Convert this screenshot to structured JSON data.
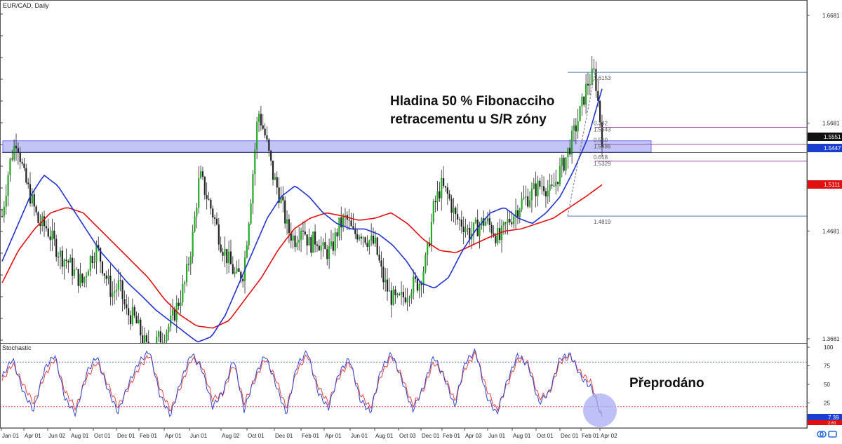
{
  "header": {
    "symbol_label": "EUR/CAD, Daily"
  },
  "colors": {
    "background": "#ffffff",
    "up_candle": "#22aa22",
    "down_candle": "#222222",
    "ma_fast": "#2233cc",
    "ma_slow": "#e01010",
    "sr_zone": "#9a9cf0",
    "fib_lines": "#a050a0",
    "fib_top_bottom": "#4a7fb0",
    "stoch_k": "#3344cc",
    "stoch_d": "#dd4444",
    "stoch_level": "#6677dd",
    "oversold_circle": "#a8acf2",
    "price_badge_current": "#111111",
    "price_badge_zone": "#1a3fd0",
    "price_badge_ma": "#e01010"
  },
  "annotations": {
    "fib_note_line1": "Hladina 50 % Fibonacciho",
    "fib_note_line2": "retracementu u S/R zóny",
    "oversold_note": "Přeprodáno"
  },
  "chart_data": [
    {
      "type": "candlestick",
      "title": "EUR/CAD, Daily",
      "ylim": [
        1.3681,
        1.6681
      ],
      "y_ticks": [
        "1.6681",
        "1.5681",
        "1.4681",
        "1.3681"
      ],
      "x_tick_labels": [
        "Jan 01",
        "Apr 01",
        "Jun 02",
        "Aug 01",
        "Oct 01",
        "Dec 01",
        "Feb 01",
        "Apr 01",
        "Jun 01",
        "Aug 02",
        "Oct 01",
        "Dec 01",
        "Feb 01",
        "Apr 01",
        "Jun 01",
        "Aug 01",
        "Oct 03",
        "Dec 01",
        "Feb 01",
        "Apr 03",
        "Jun 01",
        "Aug 01",
        "Oct 01",
        "Dec 01",
        "Feb 01",
        "Apr 02"
      ],
      "price_badges": [
        {
          "label": "1.5551",
          "role": "current"
        },
        {
          "label": "1.5447",
          "role": "zone"
        },
        {
          "label": "1.5111",
          "role": "ma"
        }
      ],
      "sr_zone": [
        1.5412,
        1.5518
      ],
      "fibonacci": {
        "levels": [
          {
            "ratio": "",
            "price": "1.6153"
          },
          {
            "ratio": "0.382",
            "price": "1.5643"
          },
          {
            "ratio": "0.500",
            "price": "1.5486"
          },
          {
            "ratio": "0.618",
            "price": "1.5329"
          },
          {
            "ratio": "",
            "price": "1.4819"
          }
        ]
      },
      "close_path": [
        1.482,
        1.53,
        1.555,
        1.518,
        1.498,
        1.475,
        1.472,
        1.458,
        1.445,
        1.44,
        1.428,
        1.42,
        1.442,
        1.452,
        1.43,
        1.41,
        1.418,
        1.392,
        1.388,
        1.372,
        1.355,
        1.365,
        1.372,
        1.382,
        1.4,
        1.42,
        1.46,
        1.52,
        1.5,
        1.48,
        1.455,
        1.44,
        1.425,
        1.43,
        1.5,
        1.58,
        1.555,
        1.52,
        1.5,
        1.47,
        1.46,
        1.475,
        1.455,
        1.462,
        1.448,
        1.45,
        1.472,
        1.48,
        1.465,
        1.468,
        1.46,
        1.455,
        1.425,
        1.408,
        1.402,
        1.408,
        1.418,
        1.42,
        1.442,
        1.49,
        1.51,
        1.5,
        1.48,
        1.475,
        1.465,
        1.472,
        1.478,
        1.47,
        1.46,
        1.475,
        1.485,
        1.495,
        1.5,
        1.508,
        1.512,
        1.502,
        1.52,
        1.535,
        1.555,
        1.578,
        1.605,
        1.615,
        1.555
      ],
      "ma_fast_path": [
        1.44,
        1.47,
        1.5,
        1.52,
        1.51,
        1.49,
        1.47,
        1.45,
        1.435,
        1.42,
        1.408,
        1.395,
        1.385,
        1.375,
        1.365,
        1.37,
        1.39,
        1.42,
        1.45,
        1.48,
        1.5,
        1.51,
        1.5,
        1.485,
        1.475,
        1.47,
        1.47,
        1.465,
        1.455,
        1.44,
        1.42,
        1.415,
        1.425,
        1.45,
        1.47,
        1.485,
        1.49,
        1.48,
        1.475,
        1.485,
        1.5,
        1.525,
        1.555,
        1.6
      ],
      "ma_slow_path": [
        1.42,
        1.45,
        1.47,
        1.485,
        1.49,
        1.485,
        1.47,
        1.455,
        1.44,
        1.425,
        1.405,
        1.39,
        1.38,
        1.378,
        1.385,
        1.405,
        1.425,
        1.45,
        1.47,
        1.48,
        1.485,
        1.482,
        1.478,
        1.48,
        1.485,
        1.475,
        1.46,
        1.45,
        1.448,
        1.455,
        1.462,
        1.468,
        1.47,
        1.475,
        1.48,
        1.49,
        1.5,
        1.511
      ]
    },
    {
      "type": "line",
      "title": "Stochastic",
      "ylim": [
        0,
        100
      ],
      "y_ticks": [
        "100",
        "75",
        "50",
        "25"
      ],
      "levels": [
        80,
        20
      ],
      "last_values": [
        "7.39",
        "2.61"
      ],
      "series": [
        {
          "values": [
            60,
            85,
            40,
            15,
            70,
            90,
            30,
            10,
            65,
            88,
            45,
            12,
            50,
            80,
            95,
            35,
            8,
            55,
            92,
            70,
            20,
            40,
            85,
            15,
            60,
            90,
            50,
            10,
            75,
            95,
            40,
            18,
            65,
            85,
            30,
            12,
            70,
            92,
            55,
            15,
            45,
            88,
            60,
            20,
            80,
            95,
            35,
            10,
            55,
            90,
            75,
            25,
            40,
            85,
            90,
            60,
            45,
            7
          ]
        },
        {
          "values": [
            55,
            78,
            50,
            25,
            60,
            85,
            40,
            18,
            58,
            80,
            52,
            20,
            45,
            72,
            90,
            45,
            15,
            48,
            85,
            75,
            30,
            38,
            78,
            25,
            55,
            85,
            58,
            18,
            68,
            90,
            48,
            25,
            60,
            80,
            38,
            18,
            62,
            88,
            60,
            22,
            42,
            80,
            62,
            28,
            72,
            92,
            45,
            15,
            50,
            84,
            78,
            32,
            38,
            80,
            88,
            65,
            52,
            3
          ]
        }
      ]
    }
  ]
}
